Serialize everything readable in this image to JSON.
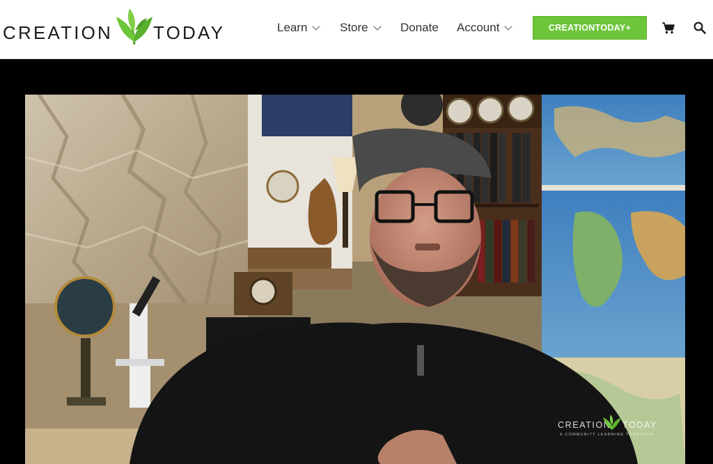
{
  "brand": {
    "word_left": "CREATION",
    "word_right": "TODAY",
    "accent_color": "#6dc53a"
  },
  "nav": {
    "items": [
      {
        "label": "Learn",
        "has_dropdown": true
      },
      {
        "label": "Store",
        "has_dropdown": true
      },
      {
        "label": "Donate",
        "has_dropdown": false
      },
      {
        "label": "Account",
        "has_dropdown": true
      }
    ]
  },
  "cta": {
    "label": "CREATIONTODAY+"
  },
  "icons": {
    "cart": "cart-icon",
    "search": "search-icon"
  },
  "video": {
    "watermark_left": "CREATION",
    "watermark_right": "TODAY",
    "watermark_tagline": "A COMMUNITY LEARNING TOGETHER"
  }
}
